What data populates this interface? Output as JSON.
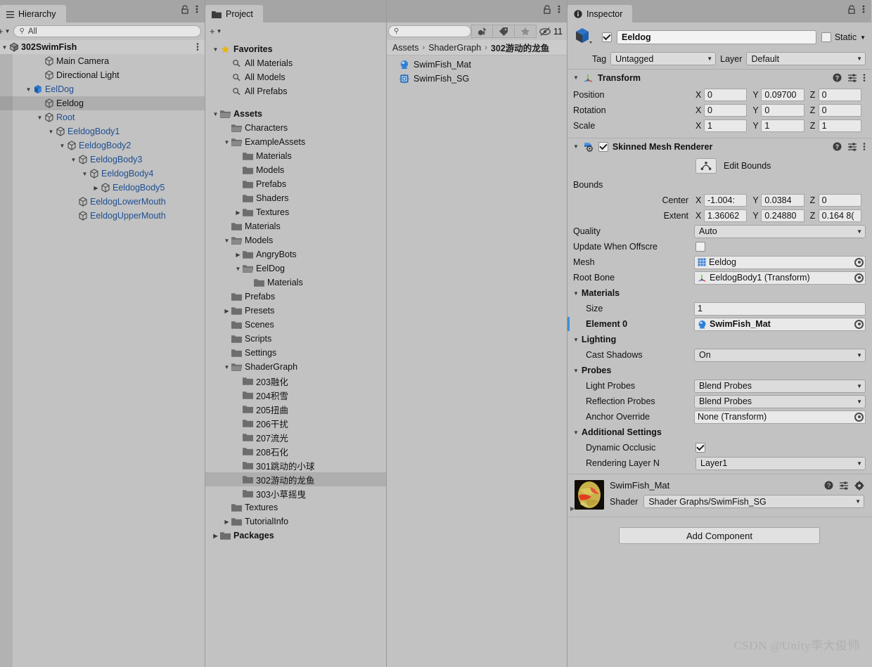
{
  "hierarchy": {
    "tab_label": "Hierarchy",
    "tab_icon": "hierarchy-icon",
    "search_placeholder": "All",
    "create_label": "+",
    "rows": [
      {
        "label": "302SwimFish",
        "depth": 0,
        "icon": "scene-icon",
        "twisty": "down",
        "kind": "scene"
      },
      {
        "label": "Main Camera",
        "depth": 2,
        "icon": "gameobject-icon",
        "twisty": "none",
        "kind": "normal"
      },
      {
        "label": "Directional Light",
        "depth": 2,
        "icon": "gameobject-icon",
        "twisty": "none",
        "kind": "normal"
      },
      {
        "label": "EelDog",
        "depth": 1,
        "icon": "prefab-icon",
        "twisty": "down",
        "kind": "prefab"
      },
      {
        "label": "Eeldog",
        "depth": 2,
        "icon": "gameobject-icon",
        "twisty": "none",
        "kind": "selected"
      },
      {
        "label": "Root",
        "depth": 2,
        "icon": "gameobject-icon",
        "twisty": "down",
        "kind": "prefab"
      },
      {
        "label": "EeldogBody1",
        "depth": 3,
        "icon": "gameobject-icon",
        "twisty": "down",
        "kind": "prefab"
      },
      {
        "label": "EeldogBody2",
        "depth": 4,
        "icon": "gameobject-icon",
        "twisty": "down",
        "kind": "prefab"
      },
      {
        "label": "EeldogBody3",
        "depth": 5,
        "icon": "gameobject-icon",
        "twisty": "down",
        "kind": "prefab"
      },
      {
        "label": "EeldogBody4",
        "depth": 6,
        "icon": "gameobject-icon",
        "twisty": "down",
        "kind": "prefab"
      },
      {
        "label": "EeldogBody5",
        "depth": 7,
        "icon": "gameobject-icon",
        "twisty": "right",
        "kind": "prefab"
      },
      {
        "label": "EeldogLowerMouth",
        "depth": 5,
        "icon": "gameobject-icon",
        "twisty": "none",
        "kind": "prefab"
      },
      {
        "label": "EeldogUpperMouth",
        "depth": 5,
        "icon": "gameobject-icon",
        "twisty": "none",
        "kind": "prefab"
      }
    ]
  },
  "project": {
    "tab_label": "Project",
    "tab_icon": "folder-icon",
    "create_label": "+",
    "search_placeholder": "",
    "count_badge": "11",
    "tree": [
      {
        "label": "Favorites",
        "depth": 0,
        "twisty": "down",
        "icon": "star-icon",
        "bold": true
      },
      {
        "label": "All Materials",
        "depth": 1,
        "twisty": "none",
        "icon": "search-icon",
        "bold": false
      },
      {
        "label": "All Models",
        "depth": 1,
        "twisty": "none",
        "icon": "search-icon",
        "bold": false
      },
      {
        "label": "All Prefabs",
        "depth": 1,
        "twisty": "none",
        "icon": "search-icon",
        "bold": false
      },
      {
        "label": "",
        "depth": 0,
        "twisty": "none",
        "icon": "spacer",
        "bold": false
      },
      {
        "label": "Assets",
        "depth": 0,
        "twisty": "down",
        "icon": "folder-open-icon",
        "bold": true
      },
      {
        "label": "Characters",
        "depth": 1,
        "twisty": "none",
        "icon": "folder-open-icon",
        "bold": false
      },
      {
        "label": "ExampleAssets",
        "depth": 1,
        "twisty": "down",
        "icon": "folder-open-icon",
        "bold": false
      },
      {
        "label": "Materials",
        "depth": 2,
        "twisty": "none",
        "icon": "folder-icon",
        "bold": false
      },
      {
        "label": "Models",
        "depth": 2,
        "twisty": "none",
        "icon": "folder-icon",
        "bold": false
      },
      {
        "label": "Prefabs",
        "depth": 2,
        "twisty": "none",
        "icon": "folder-icon",
        "bold": false
      },
      {
        "label": "Shaders",
        "depth": 2,
        "twisty": "none",
        "icon": "folder-icon",
        "bold": false
      },
      {
        "label": "Textures",
        "depth": 2,
        "twisty": "right",
        "icon": "folder-icon",
        "bold": false
      },
      {
        "label": "Materials",
        "depth": 1,
        "twisty": "none",
        "icon": "folder-icon",
        "bold": false
      },
      {
        "label": "Models",
        "depth": 1,
        "twisty": "down",
        "icon": "folder-open-icon",
        "bold": false
      },
      {
        "label": "AngryBots",
        "depth": 2,
        "twisty": "right",
        "icon": "folder-icon",
        "bold": false
      },
      {
        "label": "EelDog",
        "depth": 2,
        "twisty": "down",
        "icon": "folder-open-icon",
        "bold": false
      },
      {
        "label": "Materials",
        "depth": 3,
        "twisty": "none",
        "icon": "folder-icon",
        "bold": false
      },
      {
        "label": "Prefabs",
        "depth": 1,
        "twisty": "none",
        "icon": "folder-icon",
        "bold": false
      },
      {
        "label": "Presets",
        "depth": 1,
        "twisty": "right",
        "icon": "folder-icon",
        "bold": false
      },
      {
        "label": "Scenes",
        "depth": 1,
        "twisty": "none",
        "icon": "folder-icon",
        "bold": false
      },
      {
        "label": "Scripts",
        "depth": 1,
        "twisty": "none",
        "icon": "folder-icon",
        "bold": false
      },
      {
        "label": "Settings",
        "depth": 1,
        "twisty": "none",
        "icon": "folder-icon",
        "bold": false
      },
      {
        "label": "ShaderGraph",
        "depth": 1,
        "twisty": "down",
        "icon": "folder-open-icon",
        "bold": false
      },
      {
        "label": "203融化",
        "depth": 2,
        "twisty": "none",
        "icon": "folder-icon",
        "bold": false
      },
      {
        "label": "204积雪",
        "depth": 2,
        "twisty": "none",
        "icon": "folder-icon",
        "bold": false
      },
      {
        "label": "205扭曲",
        "depth": 2,
        "twisty": "none",
        "icon": "folder-icon",
        "bold": false
      },
      {
        "label": "206干扰",
        "depth": 2,
        "twisty": "none",
        "icon": "folder-icon",
        "bold": false
      },
      {
        "label": "207流光",
        "depth": 2,
        "twisty": "none",
        "icon": "folder-icon",
        "bold": false
      },
      {
        "label": "208石化",
        "depth": 2,
        "twisty": "none",
        "icon": "folder-icon",
        "bold": false
      },
      {
        "label": "301跳动的小球",
        "depth": 2,
        "twisty": "none",
        "icon": "folder-icon",
        "bold": false
      },
      {
        "label": "302游动的龙鱼",
        "depth": 2,
        "twisty": "none",
        "icon": "folder-icon",
        "bold": false,
        "selected": true
      },
      {
        "label": "303小草摇曳",
        "depth": 2,
        "twisty": "none",
        "icon": "folder-icon",
        "bold": false
      },
      {
        "label": "Textures",
        "depth": 1,
        "twisty": "none",
        "icon": "folder-icon",
        "bold": false
      },
      {
        "label": "TutorialInfo",
        "depth": 1,
        "twisty": "right",
        "icon": "folder-icon",
        "bold": false
      },
      {
        "label": "Packages",
        "depth": 0,
        "twisty": "right",
        "icon": "folder-icon",
        "bold": true
      }
    ],
    "breadcrumb": [
      {
        "label": "Assets",
        "last": false
      },
      {
        "label": "ShaderGraph",
        "last": false
      },
      {
        "label": "302游动的龙鱼",
        "last": true
      }
    ],
    "items": [
      {
        "label": "SwimFish_Mat",
        "icon": "material-icon"
      },
      {
        "label": "SwimFish_SG",
        "icon": "shadergraph-icon"
      }
    ]
  },
  "inspector": {
    "tab_label": "Inspector",
    "tab_icon": "info-icon",
    "gameobject": {
      "enabled": true,
      "name": "Eeldog",
      "static_label": "Static",
      "static_checked": false,
      "tag_label": "Tag",
      "tag_value": "Untagged",
      "layer_label": "Layer",
      "layer_value": "Default"
    },
    "transform": {
      "title": "Transform",
      "icon": "transform-icon",
      "rows": [
        {
          "label": "Position",
          "x": "0",
          "y": "0.09700",
          "z": "0"
        },
        {
          "label": "Rotation",
          "x": "0",
          "y": "0",
          "z": "0"
        },
        {
          "label": "Scale",
          "x": "1",
          "y": "1",
          "z": "1"
        }
      ]
    },
    "skinned_mesh_renderer": {
      "title": "Skinned Mesh Renderer",
      "icon": "skinned-mesh-renderer-icon",
      "enabled": true,
      "highlight_color": "#ef2fd6",
      "edit_bounds_label": "Edit Bounds",
      "bounds_label": "Bounds",
      "center": {
        "label": "Center",
        "x": "-1.004:",
        "y": "0.0384",
        "z": "0"
      },
      "extent": {
        "label": "Extent",
        "x": "1.36062",
        "y": "0.24880",
        "z": "0.164 8("
      },
      "quality_label": "Quality",
      "quality_value": "Auto",
      "update_offscreen_label": "Update When Offscre",
      "update_offscreen_checked": false,
      "mesh_label": "Mesh",
      "mesh_value": "Eeldog",
      "root_bone_label": "Root Bone",
      "root_bone_value": "EeldogBody1 (Transform)",
      "materials_label": "Materials",
      "size_label": "Size",
      "size_value": "1",
      "element0_label": "Element 0",
      "element0_value": "SwimFish_Mat",
      "lighting_label": "Lighting",
      "cast_shadows_label": "Cast Shadows",
      "cast_shadows_value": "On",
      "probes_label": "Probes",
      "light_probes_label": "Light Probes",
      "light_probes_value": "Blend Probes",
      "reflection_probes_label": "Reflection Probes",
      "reflection_probes_value": "Blend Probes",
      "anchor_override_label": "Anchor Override",
      "anchor_override_value": "None (Transform)",
      "additional_settings_label": "Additional Settings",
      "dynamic_occlusion_label": "Dynamic Occlusic",
      "dynamic_occlusion_checked": true,
      "rendering_layer_label": "Rendering Layer N",
      "rendering_layer_value": "Layer1"
    },
    "material": {
      "name": "SwimFish_Mat",
      "shader_label": "Shader",
      "shader_value": "Shader Graphs/SwimFish_SG"
    },
    "add_component_label": "Add Component"
  },
  "watermark": "CSDN @Unity李大俊师"
}
